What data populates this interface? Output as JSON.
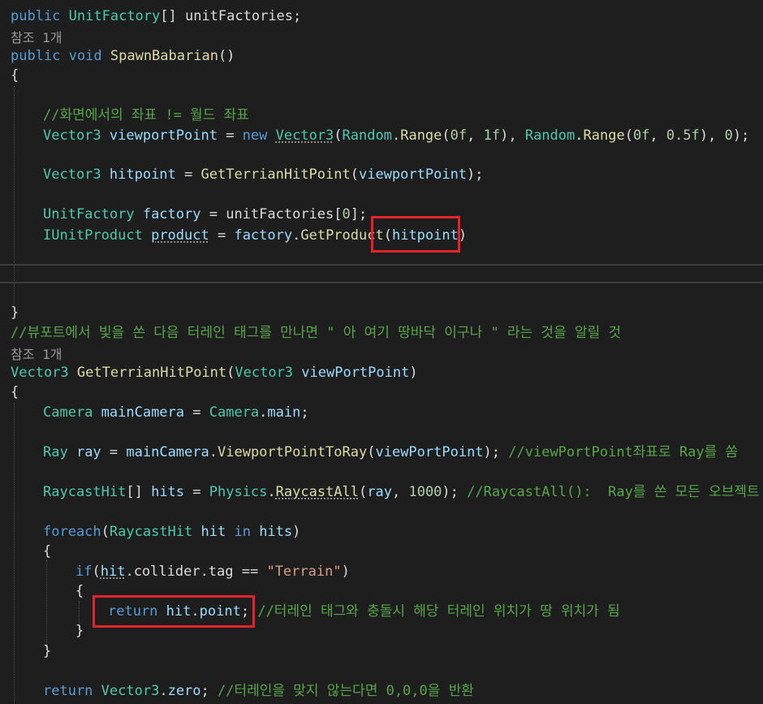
{
  "codelens": {
    "refs": "참조 1개"
  },
  "code": {
    "l1": {
      "kw": "public",
      "ty": "UnitFactory",
      "rest": "[] unitFactories;"
    },
    "l2": {
      "kw1": "public",
      "kw2": "void",
      "fn": "SpawnBabarian",
      "rest": "()"
    },
    "brace_open": "{",
    "brace_close": "}",
    "c1": "//화면에서의 좌표 != 월드 좌표",
    "l3": {
      "ty": "Vector3",
      "var": " viewportPoint",
      "eq": " = ",
      "kw": "new",
      "sp": " ",
      "ty2": "Vector3",
      "p1": "(",
      "rnd1": "Random",
      "dot1": ".",
      "fn1": "Range",
      "a1": "(",
      "n1": "0f",
      "c1": ", ",
      "n2": "1f",
      "a2": "), ",
      "rnd2": "Random",
      "dot2": ".",
      "fn2": "Range",
      "a3": "(",
      "n3": "0f",
      "c2": ", ",
      "n4": "0.5f",
      "a4": "), ",
      "n5": "0",
      "end": ");"
    },
    "l4": {
      "ty": "Vector3",
      "var": " hitpoint",
      "eq": " = ",
      "fn": "GetTerrianHitPoint",
      "p1": "(",
      "arg": "viewportPoint",
      "end": ");"
    },
    "l5": {
      "ty": "UnitFactory",
      "var": " factory",
      "eq": " = ",
      "arr": "unitFactories",
      "b1": "[",
      "n": "0",
      "b2": "];"
    },
    "l6": {
      "ty": "IUnitProduct",
      "sp": " ",
      "var": "product",
      "eq": " = ",
      "obj": "factory",
      "dot": ".",
      "fn": "GetProduct",
      "p1": "(",
      "arg": "hitpoint",
      "end": ")"
    },
    "c2": "//뷰포트에서 빛을 쏜 다음 터레인 태그를 만나면 \" 아 여기 땅바닥 이구나 \" 라는 것을 알릴 것",
    "l7": {
      "ty": "Vector3",
      "sp": " ",
      "fn": "GetTerrianHitPoint",
      "p1": "(",
      "ty2": "Vector3",
      "var": " viewPortPoint",
      "end": ")"
    },
    "l8": {
      "ty": "Camera",
      "var": " mainCamera",
      "eq": " = ",
      "ty2": "Camera",
      "dot": ".",
      "prop": "main",
      "end": ";"
    },
    "l9": {
      "ty": "Ray",
      "var": " ray",
      "eq": " = ",
      "obj": "mainCamera",
      "dot": ".",
      "fn": "ViewportPointToRay",
      "p1": "(",
      "arg": "viewPortPoint",
      "end": "); ",
      "cm": "//viewPortPoint좌표로 Ray를 쏨"
    },
    "l10": {
      "ty": "RaycastHit",
      "b": "[]",
      "var": " hits",
      "eq": " = ",
      "ty2": "Physics",
      "dot": ".",
      "fn": "RaycastAll",
      "p1": "(",
      "arg": "ray",
      "c": ", ",
      "n": "1000",
      "end": "); ",
      "cm": "//RaycastAll():  Ray를 쏜 모든 오브젝트"
    },
    "l11": {
      "kw": "foreach",
      "p1": "(",
      "ty": "RaycastHit",
      "var": " hit",
      "sp": " ",
      "kw2": "in",
      "var2": " hits",
      "end": ")"
    },
    "l12": {
      "kw": "if",
      "p1": "(",
      "var": "hit",
      "rest": ".collider.tag == ",
      "str": "\"Terrain\"",
      "end": ")"
    },
    "l13": {
      "kw": "return",
      "sp": " ",
      "var": "hit",
      "dot": ".",
      "prop": "point",
      "end": ";",
      "sp2": " ",
      "cm": "//터레인 태그와 충돌시 해당 터레인 위치가 땅 위치가 됨"
    },
    "l14": {
      "kw": "return",
      "sp": " ",
      "ty": "Vector3",
      "dot": ".",
      "prop": "zero",
      "end": "; ",
      "cm": "//터레인을 맞지 않는다면 0,0,0을 반환"
    }
  }
}
